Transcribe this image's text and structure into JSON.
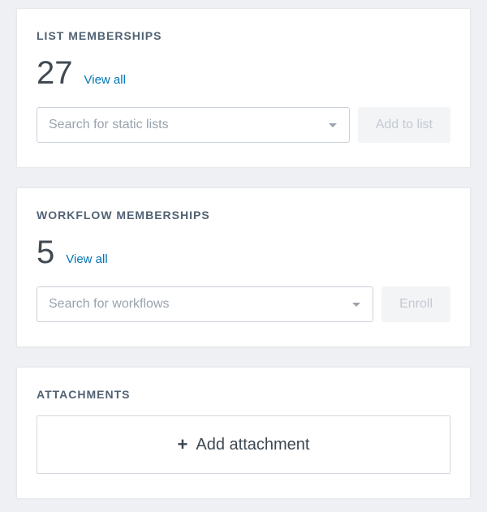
{
  "list_memberships": {
    "title": "LIST MEMBERSHIPS",
    "count": "27",
    "view_all_label": "View all",
    "search_placeholder": "Search for static lists",
    "action_label": "Add to list"
  },
  "workflow_memberships": {
    "title": "WORKFLOW MEMBERSHIPS",
    "count": "5",
    "view_all_label": "View all",
    "search_placeholder": "Search for workflows",
    "action_label": "Enroll"
  },
  "attachments": {
    "title": "ATTACHMENTS",
    "add_label": "Add attachment"
  }
}
